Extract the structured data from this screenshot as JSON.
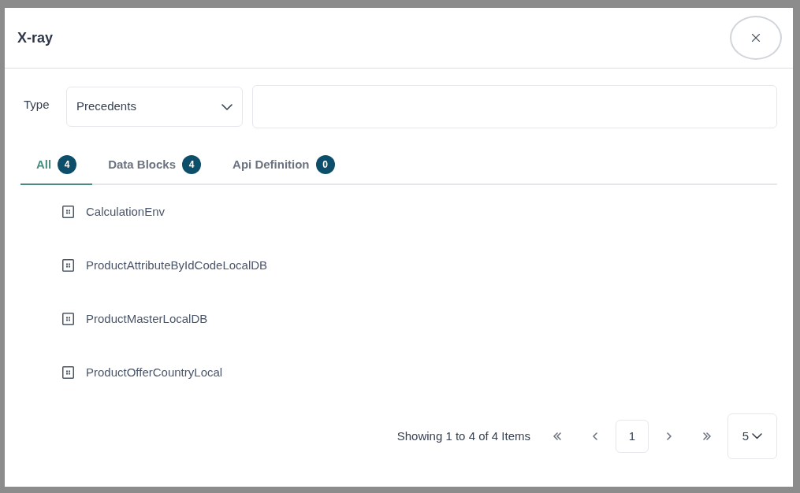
{
  "dialog": {
    "title": "X-ray"
  },
  "filter": {
    "label": "Type",
    "select_value": "Precedents"
  },
  "tabs": [
    {
      "label": "All",
      "count": "4",
      "selected": true
    },
    {
      "label": "Data Blocks",
      "count": "4",
      "selected": false
    },
    {
      "label": "Api Definition",
      "count": "0",
      "selected": false
    }
  ],
  "items": [
    {
      "name": "CalculationEnv"
    },
    {
      "name": "ProductAttributeByIdCodeLocalDB"
    },
    {
      "name": "ProductMasterLocalDB"
    },
    {
      "name": "ProductOfferCountryLocal"
    }
  ],
  "pagination": {
    "summary": "Showing 1 to 4 of 4 Items",
    "current_page": "1",
    "page_size": "5"
  }
}
